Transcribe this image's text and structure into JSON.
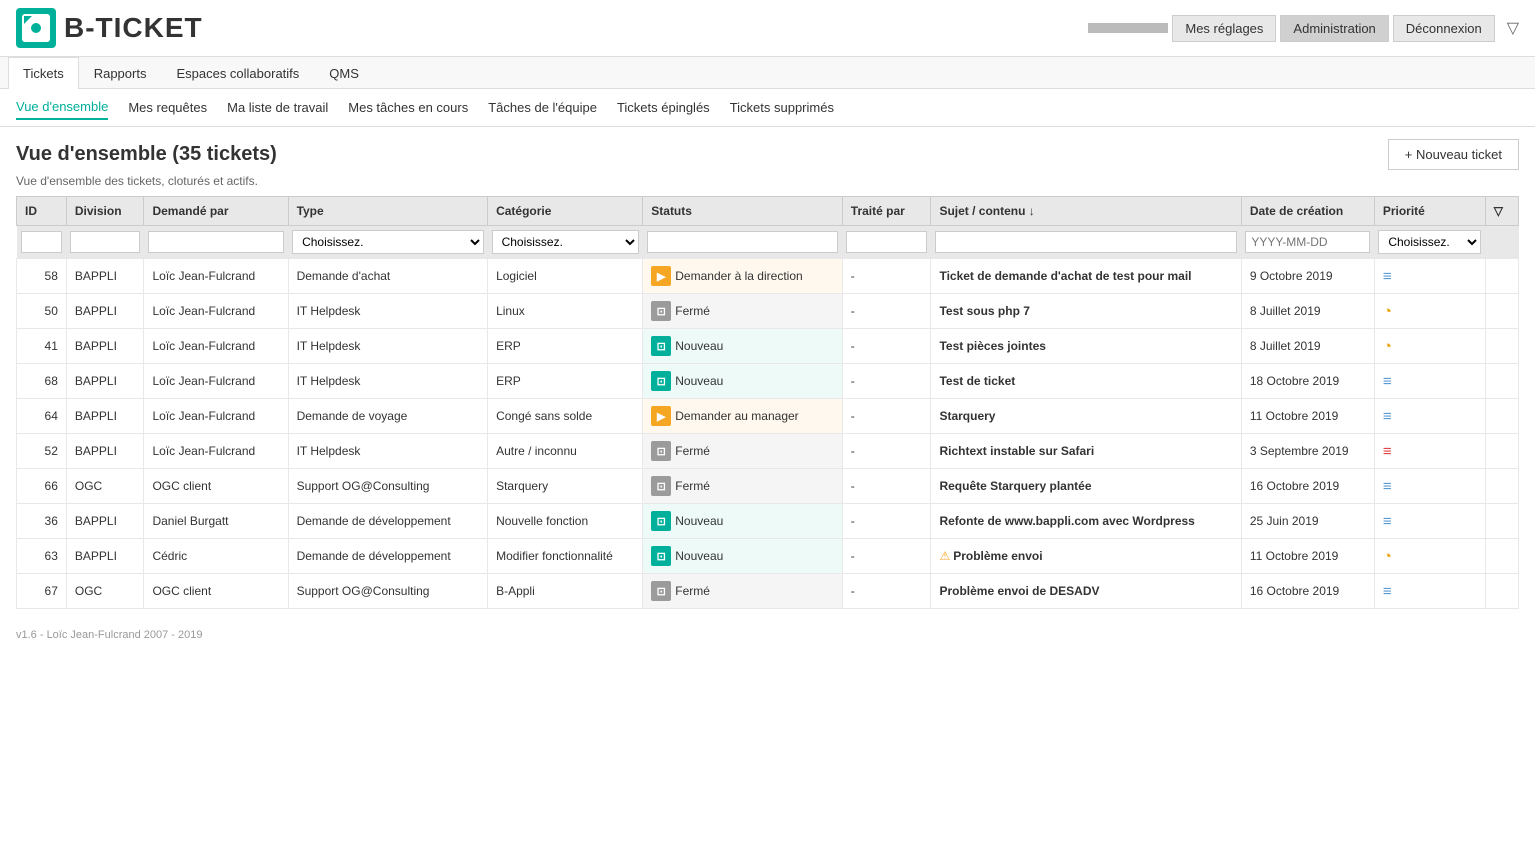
{
  "app": {
    "logo_text": "B-TICKET",
    "user_button": "",
    "filter_icon": "▽"
  },
  "top_nav": {
    "items": [
      {
        "id": "tickets",
        "label": "Tickets",
        "active": true
      },
      {
        "id": "rapports",
        "label": "Rapports",
        "active": false
      },
      {
        "id": "espaces",
        "label": "Espaces collaboratifs",
        "active": false
      },
      {
        "id": "qms",
        "label": "QMS",
        "active": false
      }
    ],
    "right_items": [
      {
        "id": "reglages",
        "label": "Mes réglages"
      },
      {
        "id": "administration",
        "label": "Administration"
      },
      {
        "id": "deconnexion",
        "label": "Déconnexion"
      }
    ]
  },
  "sub_nav": {
    "items": [
      {
        "id": "vue",
        "label": "Vue d'ensemble",
        "active": true
      },
      {
        "id": "mes_requetes",
        "label": "Mes requêtes",
        "active": false
      },
      {
        "id": "ma_liste",
        "label": "Ma liste de travail",
        "active": false
      },
      {
        "id": "mes_taches",
        "label": "Mes tâches en cours",
        "active": false
      },
      {
        "id": "taches_equipe",
        "label": "Tâches de l'équipe",
        "active": false
      },
      {
        "id": "epingles",
        "label": "Tickets épinglés",
        "active": false
      },
      {
        "id": "supprimes",
        "label": "Tickets supprimés",
        "active": false
      }
    ]
  },
  "page": {
    "title": "Vue d'ensemble (35 tickets)",
    "subtitle": "Vue d'ensemble des tickets, cloturés et actifs.",
    "new_ticket_label": "+ Nouveau ticket"
  },
  "table": {
    "columns": [
      {
        "id": "id",
        "label": "ID"
      },
      {
        "id": "division",
        "label": "Division"
      },
      {
        "id": "demande_par",
        "label": "Demandé par"
      },
      {
        "id": "type",
        "label": "Type"
      },
      {
        "id": "categorie",
        "label": "Catégorie"
      },
      {
        "id": "statuts",
        "label": "Statuts"
      },
      {
        "id": "traite_par",
        "label": "Traité par"
      },
      {
        "id": "sujet",
        "label": "Sujet / contenu ↓"
      },
      {
        "id": "date",
        "label": "Date de création"
      },
      {
        "id": "priorite",
        "label": "Priorité"
      },
      {
        "id": "filter",
        "label": ""
      }
    ],
    "filters": {
      "type_placeholder": "Choisissez.",
      "categorie_placeholder": "Choisissez.",
      "date_placeholder": "YYYY-MM-DD",
      "priorite_placeholder": "Choisissez."
    },
    "rows": [
      {
        "id": "58",
        "division": "BAPPLI",
        "demande_par": "Loïc Jean-Fulcrand",
        "type": "Demande d'achat",
        "categorie": "Logiciel",
        "statut_type": "orange",
        "statut_icon": "▶",
        "statut_label": "Demander à la direction",
        "traite_par": "-",
        "sujet": "Ticket de demande d'achat de test pour mail",
        "date": "9 Octobre 2019",
        "priorite_type": "lines",
        "has_warning": false,
        "row_bg": "white"
      },
      {
        "id": "50",
        "division": "BAPPLI",
        "demande_par": "Loïc Jean-Fulcrand",
        "type": "IT Helpdesk",
        "categorie": "Linux",
        "statut_type": "gray",
        "statut_icon": "⊡",
        "statut_label": "Fermé",
        "traite_par": "-",
        "sujet": "Test sous php 7",
        "date": "8 Juillet 2019",
        "priorite_type": "clock",
        "has_warning": false,
        "row_bg": "white"
      },
      {
        "id": "41",
        "division": "BAPPLI",
        "demande_par": "Loïc Jean-Fulcrand",
        "type": "IT Helpdesk",
        "categorie": "ERP",
        "statut_type": "teal",
        "statut_icon": "⊡",
        "statut_label": "Nouveau",
        "traite_par": "-",
        "sujet": "Test pièces jointes",
        "date": "8 Juillet 2019",
        "priorite_type": "clock",
        "has_warning": false,
        "row_bg": "white"
      },
      {
        "id": "68",
        "division": "BAPPLI",
        "demande_par": "Loïc Jean-Fulcrand",
        "type": "IT Helpdesk",
        "categorie": "ERP",
        "statut_type": "teal",
        "statut_icon": "⊡",
        "statut_label": "Nouveau",
        "traite_par": "-",
        "sujet": "Test de ticket",
        "date": "18 Octobre 2019",
        "priorite_type": "lines",
        "has_warning": false,
        "row_bg": "white"
      },
      {
        "id": "64",
        "division": "BAPPLI",
        "demande_par": "Loïc Jean-Fulcrand",
        "type": "Demande de voyage",
        "categorie": "Congé sans solde",
        "statut_type": "orange",
        "statut_icon": "▶",
        "statut_label": "Demander au manager",
        "traite_par": "-",
        "sujet": "Starquery",
        "date": "11 Octobre 2019",
        "priorite_type": "lines",
        "has_warning": false,
        "row_bg": "white"
      },
      {
        "id": "52",
        "division": "BAPPLI",
        "demande_par": "Loïc Jean-Fulcrand",
        "type": "IT Helpdesk",
        "categorie": "Autre / inconnu",
        "statut_type": "gray",
        "statut_icon": "⊡",
        "statut_label": "Fermé",
        "traite_par": "-",
        "sujet": "Richtext instable sur Safari",
        "date": "3 Septembre 2019",
        "priorite_type": "red_lines",
        "has_warning": false,
        "row_bg": "white"
      },
      {
        "id": "66",
        "division": "OGC",
        "demande_par": "OGC client",
        "type": "Support OG@Consulting",
        "categorie": "Starquery",
        "statut_type": "gray",
        "statut_icon": "⊡",
        "statut_label": "Fermé",
        "traite_par": "-",
        "sujet": "Requête Starquery plantée",
        "date": "16 Octobre 2019",
        "priorite_type": "lines",
        "has_warning": false,
        "row_bg": "white"
      },
      {
        "id": "36",
        "division": "BAPPLI",
        "demande_par": "Daniel Burgatt",
        "type": "Demande de développement",
        "categorie": "Nouvelle fonction",
        "statut_type": "teal",
        "statut_icon": "⊡",
        "statut_label": "Nouveau",
        "traite_par": "-",
        "sujet": "Refonte de www.bappli.com avec Wordpress",
        "date": "25 Juin 2019",
        "priorite_type": "lines",
        "has_warning": false,
        "row_bg": "white"
      },
      {
        "id": "63",
        "division": "BAPPLI",
        "demande_par": "Cédric",
        "type": "Demande de développement",
        "categorie": "Modifier fonctionnalité",
        "statut_type": "teal",
        "statut_icon": "⊡",
        "statut_label": "Nouveau",
        "traite_par": "-",
        "sujet": "⚠ Problème envoi",
        "date": "11 Octobre 2019",
        "priorite_type": "clock",
        "has_warning": true,
        "row_bg": "white"
      },
      {
        "id": "67",
        "division": "OGC",
        "demande_par": "OGC client",
        "type": "Support OG@Consulting",
        "categorie": "B-Appli",
        "statut_type": "gray",
        "statut_icon": "⊡",
        "statut_label": "Fermé",
        "traite_par": "-",
        "sujet": "Problème envoi de DESADV",
        "date": "16 Octobre 2019",
        "priorite_type": "lines",
        "has_warning": false,
        "row_bg": "white"
      }
    ]
  },
  "footer": {
    "version": "v1.6 - Loïc Jean-Fulcrand 2007 - 2019"
  }
}
